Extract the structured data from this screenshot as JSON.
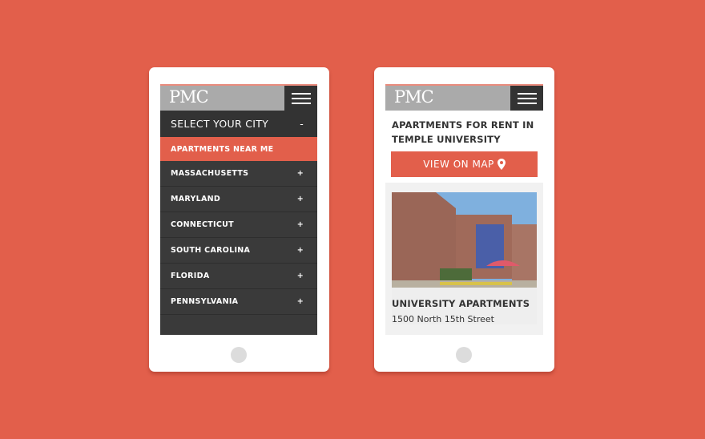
{
  "theme": {
    "accent": "#e25f4b",
    "dark": "#333333",
    "logo_bg": "#aaaaaa"
  },
  "phone1": {
    "logo": "PMC",
    "menu_icon": "hamburger-icon",
    "select_city": {
      "label": "SELECT YOUR CITY",
      "toggle": "-"
    },
    "highlight": "APARTMENTS NEAR ME",
    "states": [
      {
        "label": "MASSACHUSETTS",
        "toggle": "+"
      },
      {
        "label": "MARYLAND",
        "toggle": "+"
      },
      {
        "label": "CONNECTICUT",
        "toggle": "+"
      },
      {
        "label": "SOUTH CAROLINA",
        "toggle": "+"
      },
      {
        "label": "FLORIDA",
        "toggle": "+"
      },
      {
        "label": "PENNSYLVANIA",
        "toggle": "+"
      }
    ]
  },
  "phone2": {
    "logo": "PMC",
    "menu_icon": "hamburger-icon",
    "title": "APARTMENTS FOR RENT IN TEMPLE UNIVERSITY",
    "map_button": "VIEW ON MAP",
    "listing": {
      "name": "UNIVERSITY APARTMENTS",
      "address": "1500 North 15th Street"
    }
  }
}
